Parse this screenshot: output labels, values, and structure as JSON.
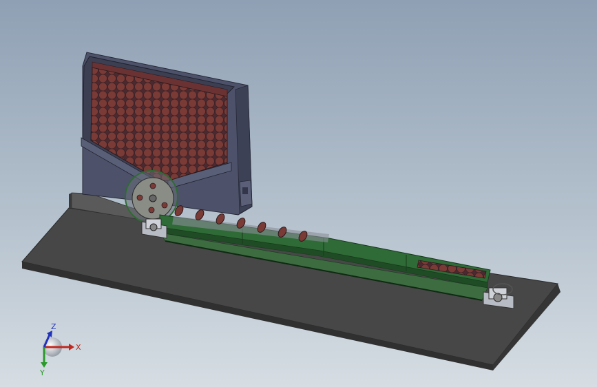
{
  "viewport": {
    "background_top": "#8fa0b4",
    "background_bottom": "#d6dde3"
  },
  "model": {
    "base_plate_color": "#444444",
    "hopper_frame_color": "#4d526a",
    "hopper_inner_color": "#3c3f52",
    "roller_color": "#7a3a36",
    "conveyor_color": "#2f6b36",
    "bearing_color": "#b8bcc4"
  },
  "triad": {
    "x_label": "X",
    "y_label": "Y",
    "z_label": "Z",
    "x_color": "#c0281e",
    "y_color": "#2a9a2a",
    "z_color": "#2233bb"
  }
}
